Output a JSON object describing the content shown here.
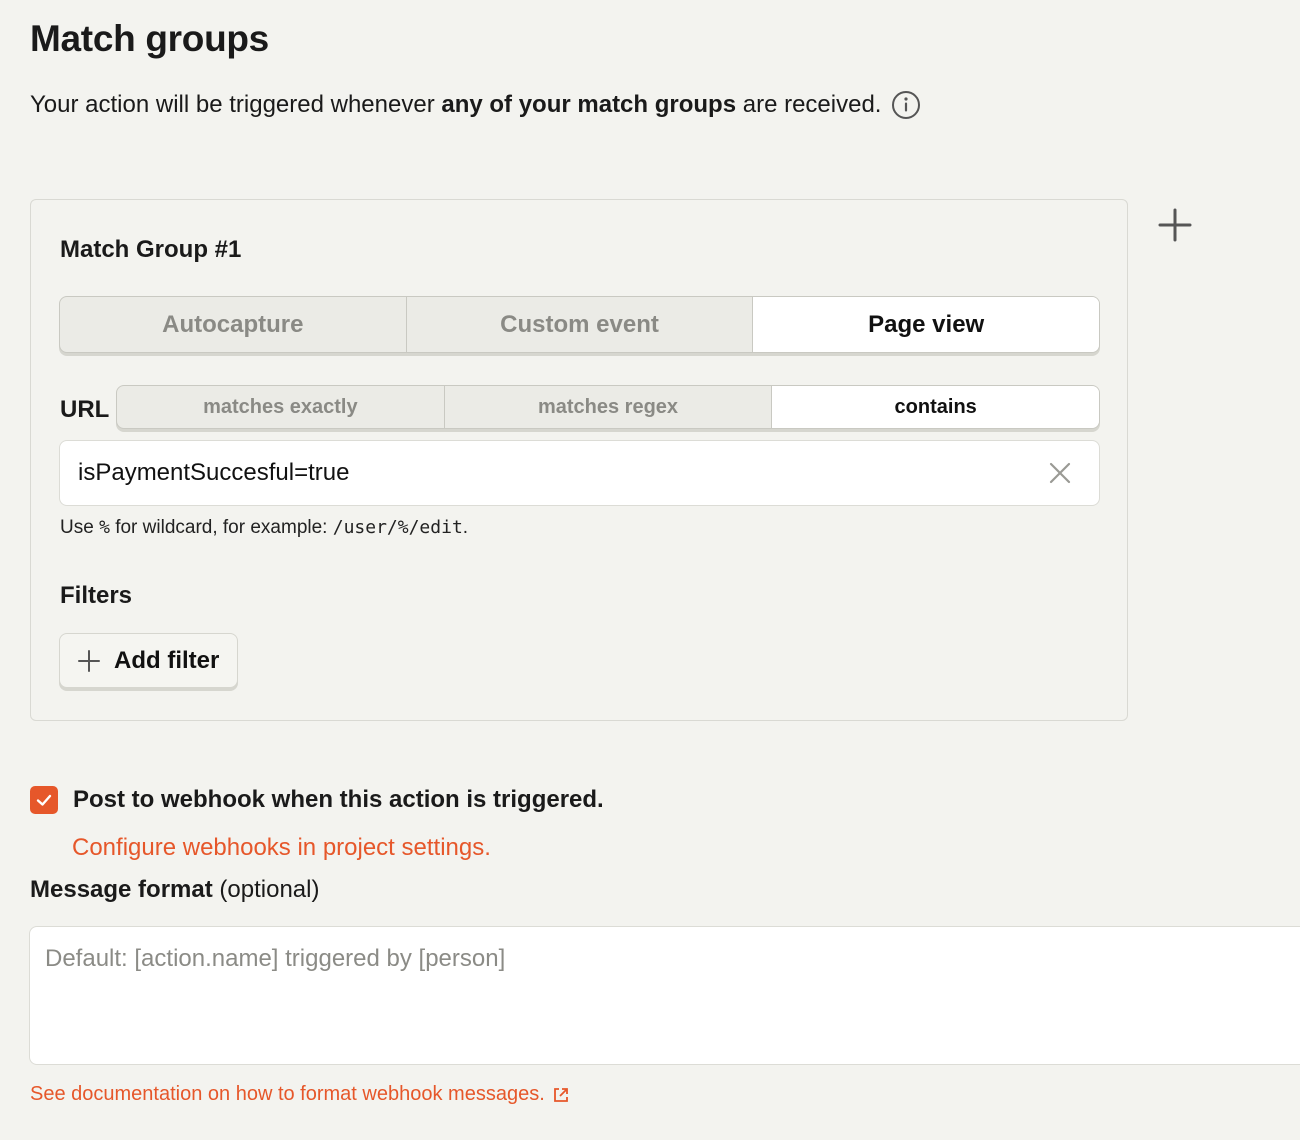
{
  "page": {
    "title": "Match groups",
    "subtitle_pre": "Your action will be triggered whenever ",
    "subtitle_bold": "any of your match groups",
    "subtitle_post": " are received."
  },
  "match_group": {
    "title": "Match Group #1",
    "event_types": [
      {
        "label": "Autocapture",
        "active": false
      },
      {
        "label": "Custom event",
        "active": false
      },
      {
        "label": "Page view",
        "active": true
      }
    ],
    "url_label": "URL",
    "url_match_types": [
      {
        "label": "matches exactly",
        "active": false
      },
      {
        "label": "matches regex",
        "active": false
      },
      {
        "label": "contains",
        "active": true
      }
    ],
    "url_value": "isPaymentSuccesful=true",
    "hint_pre": "Use ",
    "hint_wild": "%",
    "hint_mid": " for wildcard, for example: ",
    "hint_example": "/user/%/edit",
    "hint_post": ".",
    "filters_label": "Filters",
    "add_filter_label": "Add filter"
  },
  "webhook": {
    "checked": true,
    "label": "Post to webhook when this action is triggered.",
    "configure_link": "Configure webhooks in project settings.",
    "message_format_label": "Message format",
    "message_format_optional": " (optional)",
    "message_placeholder": "Default: [action.name] triggered by [person]",
    "docs_link": "See documentation on how to format webhook messages."
  },
  "colors": {
    "accent": "#e6572a",
    "background": "#f3f3ef"
  },
  "icons": {
    "info": "info-icon",
    "add_group": "plus-icon",
    "clear": "close-icon",
    "add_filter": "plus-icon",
    "checkbox": "check-icon",
    "external": "external-link-icon"
  }
}
